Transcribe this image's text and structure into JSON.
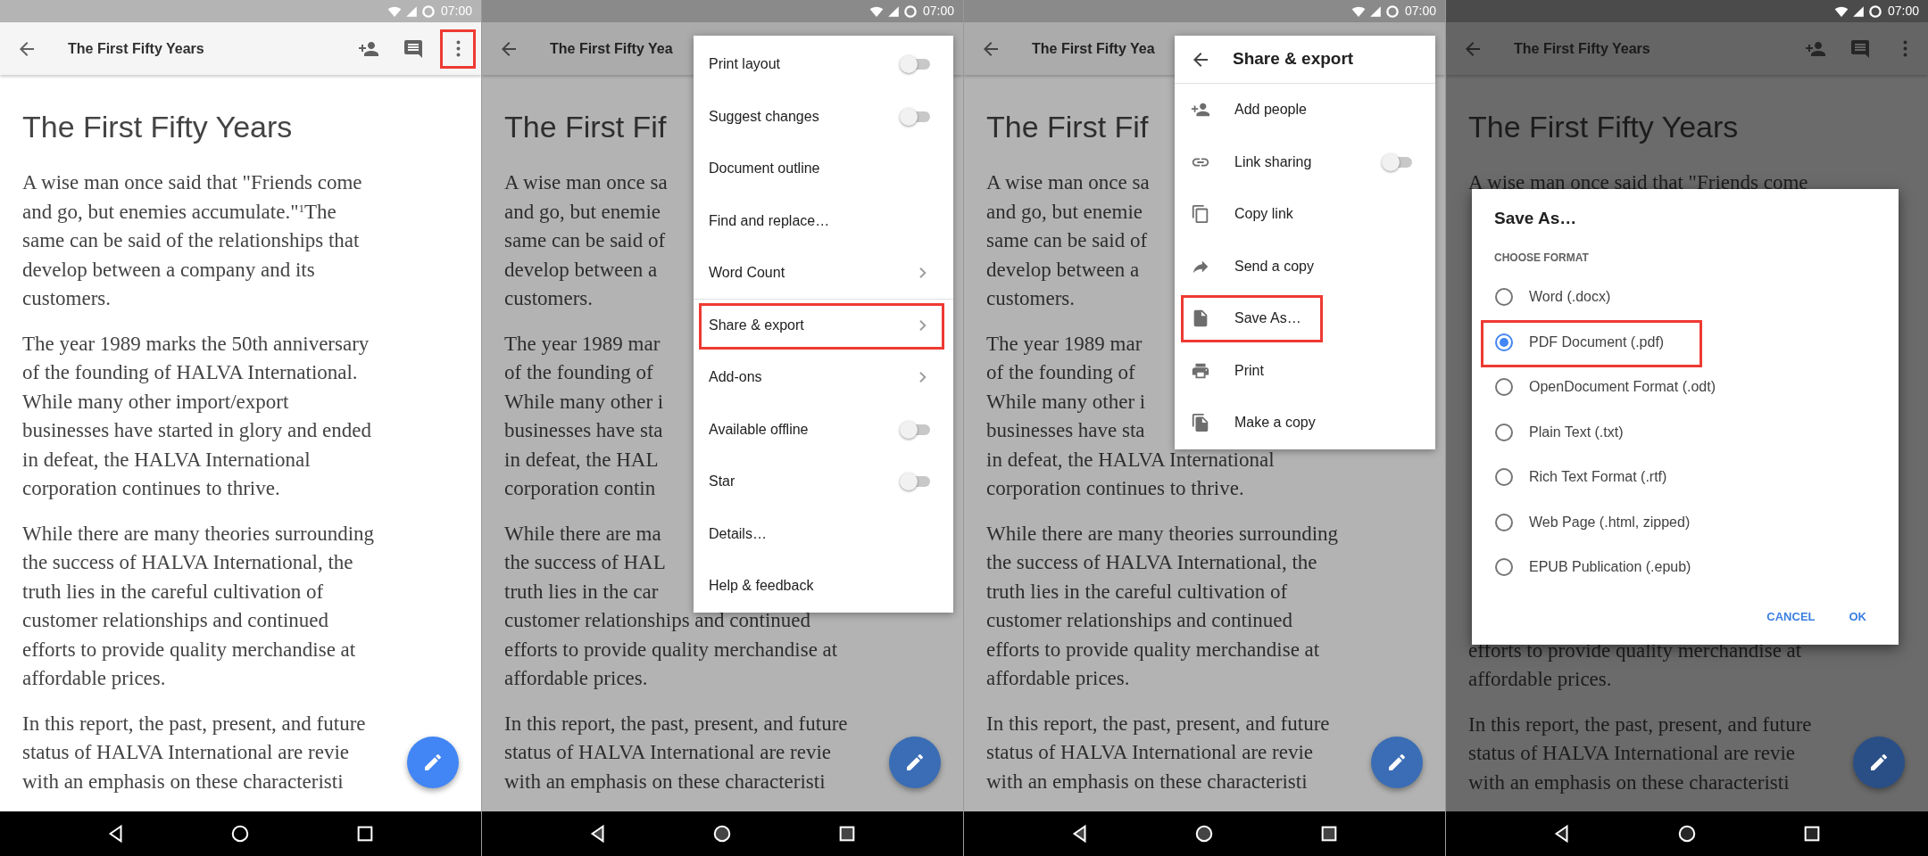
{
  "panels": [
    {
      "status_bar": {
        "time": "07:00"
      },
      "dimmed": false,
      "toolbar": {
        "title": "The First Fifty Years",
        "show_actions": true,
        "more_highlighted": true
      },
      "document": {
        "heading": "The First Fifty Years",
        "paragraphs": [
          [
            "A wise man once said that \"Friends come",
            "and go, but enemies accumulate.\"$^{1}$The",
            "same can be said of the relationships that",
            "develop between a company and its",
            "customers."
          ],
          [
            "The year 1989 marks the 50th anniversary",
            "of the founding of HALVA International.",
            "While many other import/export",
            "businesses have started in glory and ended",
            "in defeat, the HALVA International",
            "corporation continues to thrive."
          ],
          [
            "While there are many theories surrounding",
            "the success of HALVA International, the",
            "truth lies in the careful cultivation of",
            "customer relationships and continued",
            "efforts to provide quality merchandise at",
            "affordable prices."
          ],
          [
            "In this report, the past, present, and future",
            "status of HALVA International are revie",
            "with an emphasis on these characteristi"
          ]
        ]
      }
    },
    {
      "status_bar": {
        "time": "07:00"
      },
      "dimmed": true,
      "toolbar": {
        "title": "The First Fifty Yea"
      },
      "document": {
        "heading": "The First Fif",
        "paragraphs": [
          [
            "A wise man once sa",
            "and go, but enemie",
            "same can be said of",
            "develop between a",
            "customers."
          ],
          [
            "The year 1989 mar",
            "of the founding of",
            "While many other i",
            "businesses have sta",
            "in defeat, the HAL",
            "corporation contin"
          ],
          [
            "While there are ma",
            "the success of HAL",
            "truth lies in the car",
            "customer relationships and continued",
            "efforts to provide quality merchandise at",
            "affordable prices."
          ],
          [
            "In this report, the past, present, and future",
            "status of HALVA International are revie",
            "with an emphasis on these characteristi"
          ]
        ]
      },
      "overlay": {
        "kind": "menu",
        "items": [
          {
            "label": "Print layout",
            "kind": "toggle",
            "on": false
          },
          {
            "label": "Suggest changes",
            "kind": "toggle",
            "on": false
          },
          {
            "label": "Document outline",
            "kind": "plain"
          },
          {
            "label": "Find and replace…",
            "kind": "plain"
          },
          {
            "label": "Word Count",
            "kind": "submenu",
            "divider_after": true
          },
          {
            "label": "Share & export",
            "kind": "submenu",
            "highlighted": true
          },
          {
            "label": "Add-ons",
            "kind": "submenu"
          },
          {
            "label": "Available offline",
            "kind": "toggle",
            "on": false
          },
          {
            "label": "Star",
            "kind": "toggle",
            "on": false
          },
          {
            "label": "Details…",
            "kind": "plain"
          },
          {
            "label": "Help & feedback",
            "kind": "plain"
          }
        ]
      }
    },
    {
      "status_bar": {
        "time": "07:00"
      },
      "dimmed": true,
      "toolbar": {
        "title": "The First Fifty Yea"
      },
      "document": {
        "heading": "The First Fif",
        "paragraphs": [
          [
            "A wise man once sa",
            "and go, but enemie",
            "same can be said of",
            "develop between a",
            "customers."
          ],
          [
            "The year 1989 mar",
            "of the founding of",
            "While many other i",
            "businesses have sta",
            "in defeat, the HALVA International",
            "corporation continues to thrive."
          ],
          [
            "While there are many theories surrounding",
            "the success of HALVA International, the",
            "truth lies in the careful cultivation of",
            "customer relationships and continued",
            "efforts to provide quality merchandise at",
            "affordable prices."
          ],
          [
            "In this report, the past, present, and future",
            "status of HALVA International are revie",
            "with an emphasis on these characteristi"
          ]
        ]
      },
      "overlay": {
        "kind": "submenu",
        "title": "Share & export",
        "items": [
          {
            "label": "Add people",
            "kind": "plain"
          },
          {
            "label": "Link sharing",
            "kind": "toggle",
            "on": false
          },
          {
            "label": "Copy link",
            "kind": "plain"
          },
          {
            "label": "Send a copy",
            "kind": "plain"
          },
          {
            "label": "Save As…",
            "kind": "plain",
            "highlighted": true
          },
          {
            "label": "Print",
            "kind": "plain"
          },
          {
            "label": "Make a copy",
            "kind": "plain"
          }
        ]
      }
    },
    {
      "status_bar": {
        "time": "07:00"
      },
      "dimmed": true,
      "toolbar": {
        "title": "The First Fifty Years",
        "show_actions": true,
        "more_highlighted": false
      },
      "document": {
        "heading": "The First Fifty Years",
        "paragraphs": [
          [
            "A wise man once said that \"Friends come"
          ]
        ],
        "lower_paragraphs": [
          [
            "efforts to provide quality merchandise at",
            "affordable prices."
          ],
          [
            "In this report, the past, present, and future",
            "status of HALVA International are revie",
            "with an emphasis on these characteristi"
          ]
        ]
      },
      "overlay": {
        "kind": "dialog",
        "title": "Save As…",
        "section": "CHOOSE FORMAT",
        "options": [
          {
            "label": "Word (.docx)",
            "selected": false
          },
          {
            "label": "PDF Document (.pdf)",
            "selected": true,
            "highlighted": true
          },
          {
            "label": "OpenDocument Format (.odt)",
            "selected": false
          },
          {
            "label": "Plain Text (.txt)",
            "selected": false
          },
          {
            "label": "Rich Text Format (.rtf)",
            "selected": false
          },
          {
            "label": "Web Page (.html, zipped)",
            "selected": false
          },
          {
            "label": "EPUB Publication (.epub)",
            "selected": false
          }
        ],
        "buttons": [
          "CANCEL",
          "OK"
        ]
      }
    }
  ]
}
